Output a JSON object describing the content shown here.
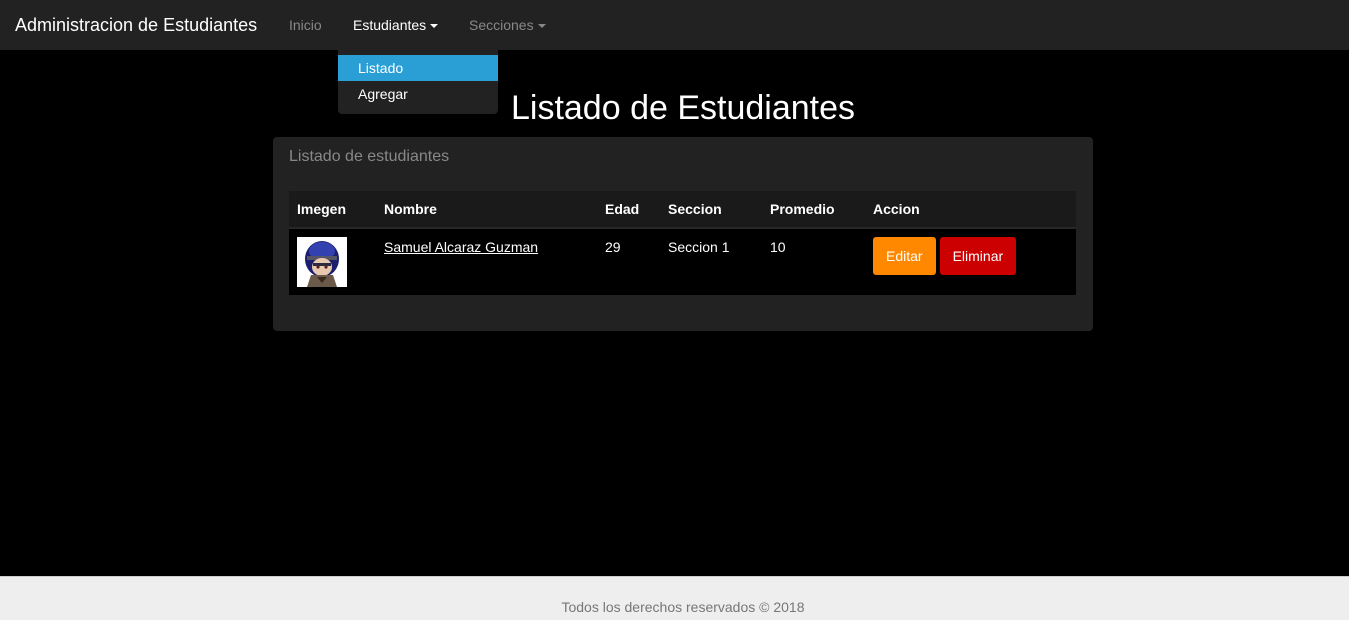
{
  "navbar": {
    "brand": "Administracion de Estudiantes",
    "items": [
      {
        "label": "Inicio"
      },
      {
        "label": "Estudiantes"
      },
      {
        "label": "Secciones"
      }
    ],
    "dropdown": {
      "items": [
        {
          "label": "Listado"
        },
        {
          "label": "Agregar"
        }
      ]
    }
  },
  "page": {
    "title": "Listado de Estudiantes"
  },
  "panel": {
    "heading": "Listado de estudiantes",
    "table": {
      "headers": [
        "Imegen",
        "Nombre",
        "Edad",
        "Seccion",
        "Promedio",
        "Accion"
      ],
      "rows": [
        {
          "nombre": "Samuel Alcaraz Guzman",
          "edad": "29",
          "seccion": "Seccion 1",
          "promedio": "10",
          "edit_label": "Editar",
          "delete_label": "Eliminar"
        }
      ]
    }
  },
  "footer": {
    "text": "Todos los derechos reservados © 2018"
  },
  "colors": {
    "navbar_bg": "#222222",
    "accent_blue": "#2a9fd6",
    "edit_orange": "#ff8800",
    "delete_red": "#cc0000"
  }
}
